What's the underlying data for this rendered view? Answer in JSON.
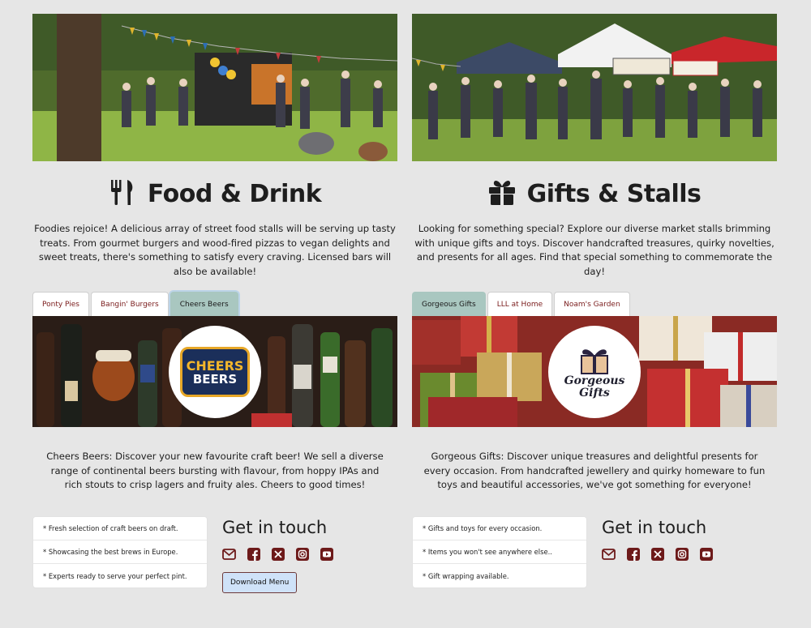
{
  "food": {
    "title": "Food & Drink",
    "icon": "utensils-icon",
    "intro": "Foodies rejoice! A delicious array of street food stalls will be serving up tasty treats. From gourmet burgers and wood-fired pizzas to vegan delights and sweet treats, there's something to satisfy every craving. Licensed bars will also be available!",
    "tabs": [
      "Ponty Pies",
      "Bangin' Burgers",
      "Cheers Beers"
    ],
    "active_tab": "Cheers Beers",
    "logo_line1": "CHEERS",
    "logo_line2": "BEERS",
    "blurb": "Cheers Beers: Discover your new favourite craft beer! We sell a diverse range of continental beers bursting with flavour, from hoppy IPAs and rich stouts to crisp lagers and fruity ales. Cheers to good times!",
    "features": [
      "* Fresh selection of craft beers on draft.",
      "* Showcasing the best brews in Europe.",
      "* Experts ready to serve your perfect pint."
    ],
    "contact_title": "Get in touch",
    "button_label": "Download Menu"
  },
  "gifts": {
    "title": "Gifts & Stalls",
    "icon": "gift-icon",
    "intro": "Looking for something special? Explore our diverse market stalls brimming with unique gifts and toys. Discover handcrafted treasures, quirky novelties, and presents for all ages. Find that special something to commemorate the day!",
    "tabs": [
      "Gorgeous Gifts",
      "LLL at Home",
      "Noam's Garden"
    ],
    "active_tab": "Gorgeous Gifts",
    "logo_line1": "Gorgeous",
    "logo_line2": "Gifts",
    "blurb": "Gorgeous Gifts: Discover unique treasures and delightful presents for every occasion. From handcrafted jewellery and quirky homeware to fun toys and beautiful accessories, we've got something for everyone!",
    "features": [
      "* Gifts and toys for every occasion.",
      "* Items you won't see anywhere else..",
      "* Gift wrapping available."
    ],
    "contact_title": "Get in touch"
  },
  "socials": [
    "email-icon",
    "facebook-icon",
    "x-twitter-icon",
    "instagram-icon",
    "youtube-icon"
  ],
  "colors": {
    "accent": "#6d1a1a",
    "active_tab": "#a9c7c0",
    "button": "#cfe2f8",
    "background": "#e6e6e6"
  }
}
